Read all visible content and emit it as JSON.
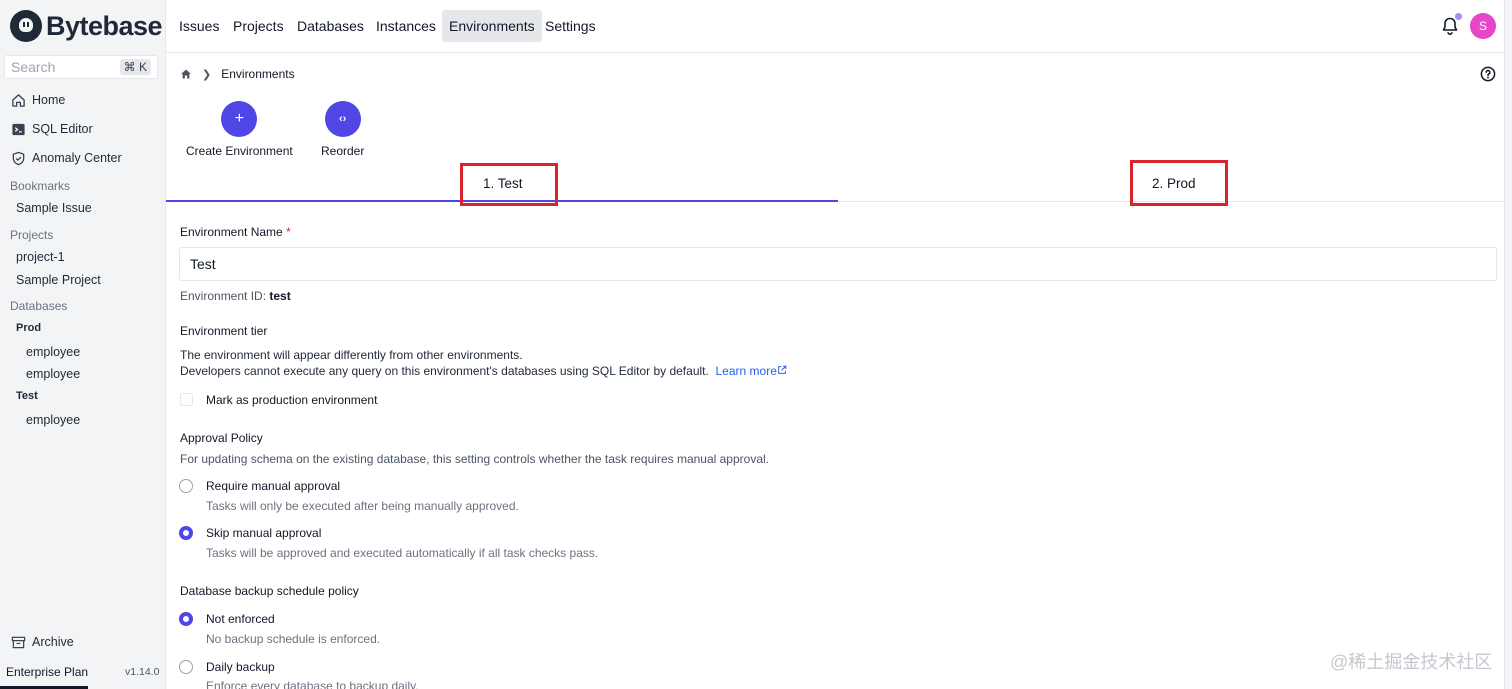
{
  "sidebar": {
    "brand": "Bytebase",
    "search": {
      "placeholder": "Search",
      "shortcut": "⌘ K"
    },
    "nav": [
      {
        "label": "Home",
        "icon": "home-icon"
      },
      {
        "label": "SQL Editor",
        "icon": "terminal-icon"
      },
      {
        "label": "Anomaly Center",
        "icon": "shield-icon"
      }
    ],
    "bookmarks": {
      "label": "Bookmarks",
      "items": [
        "Sample Issue"
      ]
    },
    "projects": {
      "label": "Projects",
      "items": [
        "project-1",
        "Sample Project"
      ]
    },
    "databases": {
      "label": "Databases",
      "groups": [
        {
          "name": "Prod",
          "items": [
            "employee",
            "employee"
          ]
        },
        {
          "name": "Test",
          "items": [
            "employee"
          ]
        }
      ]
    },
    "archive": "Archive",
    "plan": "Enterprise Plan",
    "version": "v1.14.0"
  },
  "topnav": {
    "items": [
      "Issues",
      "Projects",
      "Databases",
      "Instances",
      "Environments",
      "Settings"
    ],
    "active": "Environments",
    "avatar_initial": "S"
  },
  "breadcrumb": {
    "current": "Environments"
  },
  "actions": {
    "create": {
      "label": "Create Environment",
      "icon": "plus-icon"
    },
    "reorder": {
      "label": "Reorder",
      "icon": "code-brackets-icon"
    }
  },
  "tabs": [
    {
      "label": "1. Test",
      "active": true
    },
    {
      "label": "2. Prod",
      "active": false
    }
  ],
  "form": {
    "name_label": "Environment Name",
    "required_mark": "*",
    "name_value": "Test",
    "env_id_prefix": "Environment ID:",
    "env_id_value": "test",
    "tier": {
      "title": "Environment tier",
      "desc1": "The environment will appear differently from other environments.",
      "desc2": "Developers cannot execute any query on this environment's databases using SQL Editor by default.",
      "learn_more": "Learn more",
      "checkbox_label": "Mark as production environment",
      "checked": false
    },
    "approval": {
      "title": "Approval Policy",
      "desc": "For updating schema on the existing database, this setting controls whether the task requires manual approval.",
      "options": [
        {
          "title": "Require manual approval",
          "desc": "Tasks will only be executed after being manually approved.",
          "selected": false
        },
        {
          "title": "Skip manual approval",
          "desc": "Tasks will be approved and executed automatically if all task checks pass.",
          "selected": true
        }
      ]
    },
    "backup": {
      "title": "Database backup schedule policy",
      "options": [
        {
          "title": "Not enforced",
          "desc": "No backup schedule is enforced.",
          "selected": true
        },
        {
          "title": "Daily backup",
          "desc": "Enforce every database to backup daily.",
          "selected": false
        }
      ]
    }
  },
  "watermark": "@稀土掘金技术社区",
  "colors": {
    "accent": "#4f46e5",
    "annotation": "#d9232d",
    "avatar": "#e646c8",
    "link": "#2563eb"
  }
}
